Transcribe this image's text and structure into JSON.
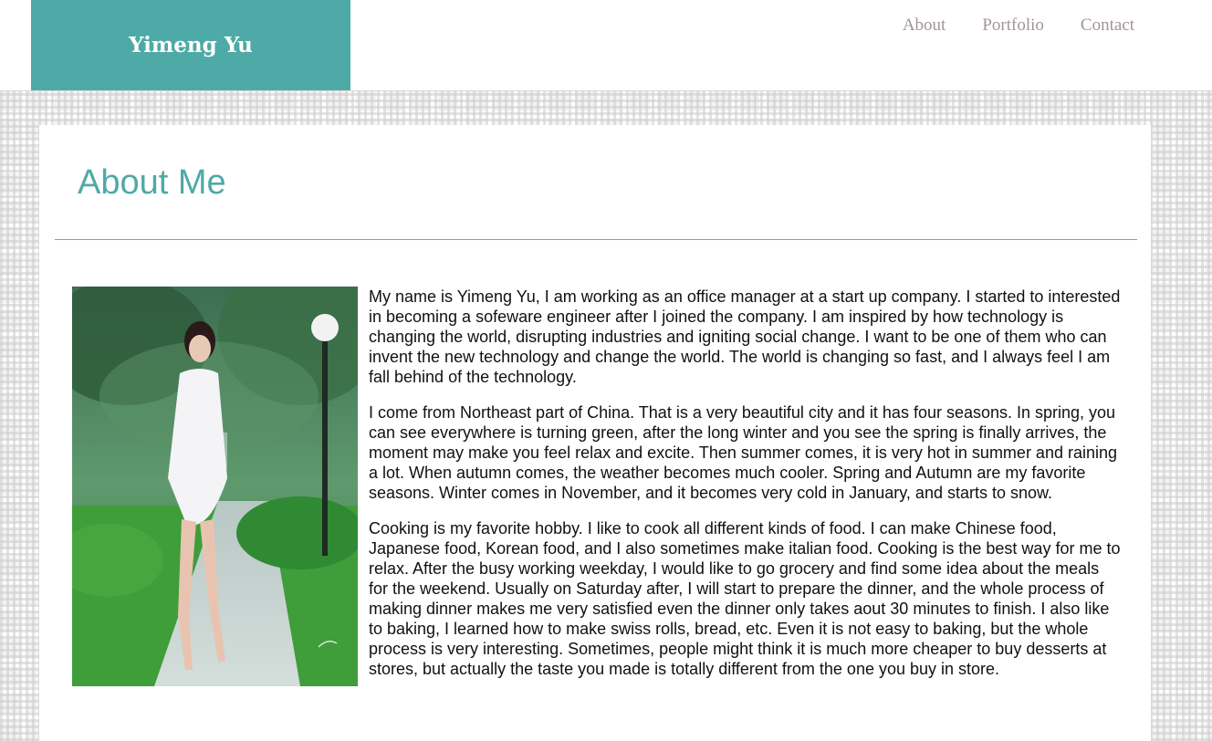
{
  "header": {
    "brand": "Yimeng Yu",
    "nav": [
      "About",
      "Portfolio",
      "Contact"
    ]
  },
  "main": {
    "title": "About Me",
    "paragraphs": [
      "My name is Yimeng Yu, I am working as an office manager at a start up company. I started to interested in becoming a sofeware engineer after I joined the company. I am inspired by how technology is changing the world, disrupting industries and igniting social change. I want to be one of them who can invent the new technology and change the world. The world is changing so fast, and I always feel I am fall behind of the technology.",
      "I come from Northeast part of China. That is a very beautiful city and it has four seasons. In spring, you can see everywhere is turning green, after the long winter and you see the spring is finally arrives, the moment may make you feel relax and excite. Then summer comes, it is very hot in summer and raining a lot. When autumn comes, the weather becomes much cooler. Spring and Autumn are my favorite seasons. Winter comes in November, and it becomes very cold in January, and starts to snow.",
      "Cooking is my favorite hobby. I like to cook all different kinds of food. I can make Chinese food, Japanese food, Korean food, and I also sometimes make italian food. Cooking is the best way for me to relax. After the busy working weekday, I would like to go grocery and find some idea about the meals for the weekend. Usually on Saturday after, I will start to prepare the dinner, and the whole process of making dinner makes me very satisfied even the dinner only takes aout 30 minutes to finish. I also like to baking, I learned how to make swiss rolls, bread, etc. Even it is not easy to baking, but the whole process is very interesting. Sometimes, people might think it is much more cheaper to buy desserts at stores, but actually the taste you made is totally different from the one you buy in store."
    ]
  },
  "colors": {
    "accent": "#4eaaa6",
    "nav_text": "#a29497"
  }
}
